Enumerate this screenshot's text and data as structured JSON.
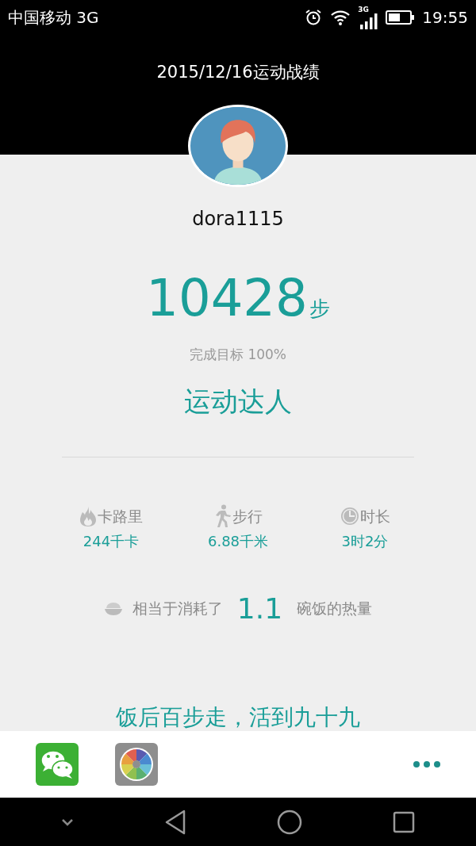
{
  "status_bar": {
    "carrier": "中国移动 3G",
    "network": "3G",
    "time": "19:55"
  },
  "header": {
    "title": "2015/12/16运动战绩"
  },
  "profile": {
    "username": "dora1115"
  },
  "steps": {
    "count": "10428",
    "unit": "步",
    "goal": "完成目标 100%",
    "title": "运动达人"
  },
  "stats": [
    {
      "kind": "calories",
      "label": "卡路里",
      "value": "244千卡"
    },
    {
      "kind": "walk",
      "label": "步行",
      "value": "6.88千米"
    },
    {
      "kind": "duration",
      "label": "时长",
      "value": "3时2分"
    }
  ],
  "equivalent": {
    "before": "相当于消耗了",
    "value": "1.1",
    "after": "碗饭的热量"
  },
  "slogan": "饭后百步走，活到九十九"
}
